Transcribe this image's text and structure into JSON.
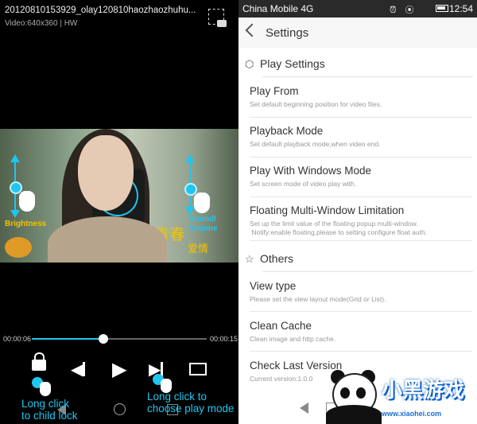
{
  "player": {
    "title": "20120810153929_olay120810haozhaozhuhu...",
    "info": "Video:640x360 | HW",
    "brightness_label": "Brightness",
    "sound_label": "Sound/ Volume",
    "subtitle_main": "25岁 青春",
    "subtitle_small": "爱情",
    "current_time": "00:00:06",
    "total_time": "00:00:15",
    "progress": 0.41,
    "hint_lock": "Long click\nto child lock",
    "hint_mode": "Long click to\nchoose play mode",
    "icons": [
      "screenshot-icon",
      "volume-icon",
      "lock-icon",
      "previous-icon",
      "play-icon",
      "next-icon",
      "play-mode-icon"
    ]
  },
  "status": {
    "carrier": "China Mobile 4G",
    "time": "12:54"
  },
  "settings": {
    "title": "Settings",
    "sections": [
      {
        "title": "Play Settings",
        "items": [
          {
            "title": "Play From",
            "subtitle": "Set default beginning position for video files."
          },
          {
            "title": "Playback Mode",
            "subtitle": "Set default playback mode,when video end."
          },
          {
            "title": "Play With Windows Mode",
            "subtitle": "Set screen mode of video play with."
          },
          {
            "title": "Floating Multi-Window Limitation",
            "subtitle": "Set up the limit value of the floating popup multi-window.\n Notify:enable floating,please to setting configure float auth."
          }
        ]
      },
      {
        "title": "Others",
        "items": [
          {
            "title": "View type",
            "subtitle": "Please set the view layout mode(Grid or List)."
          },
          {
            "title": "Clean Cache",
            "subtitle": "Clean image and http cache."
          },
          {
            "title": "Check Last Version",
            "subtitle": "Current version:1.0.0"
          }
        ]
      }
    ]
  },
  "watermark": {
    "brand": "小黑游戏",
    "url": "www.xiaohei.com"
  },
  "colors": {
    "accent": "#1fc6f0",
    "subtitle_yellow": "#f2c300"
  }
}
